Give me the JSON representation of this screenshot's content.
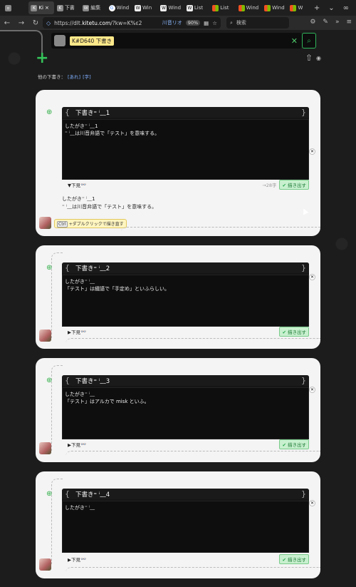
{
  "browser": {
    "tabs": [
      {
        "label": "",
        "icon": "blank"
      },
      {
        "label": "Ki",
        "icon": "kitetu",
        "active": true
      },
      {
        "label": "下書",
        "icon": "kitetu"
      },
      {
        "label": "編集",
        "icon": "wiki"
      },
      {
        "label": "Wind",
        "icon": "google"
      },
      {
        "label": "Win",
        "icon": "w"
      },
      {
        "label": "Wind",
        "icon": "w"
      },
      {
        "label": "List",
        "icon": "w"
      },
      {
        "label": "List",
        "icon": "ms"
      },
      {
        "label": "Wind",
        "icon": "ms"
      },
      {
        "label": "Wind",
        "icon": "ms"
      },
      {
        "label": "W",
        "icon": "ms"
      }
    ],
    "tab_tools": {
      "new_tab": "+",
      "list": "⌄"
    },
    "url_prefix": "https://dlt.",
    "url_host": "kitetu.com",
    "url_rest": "/?kw=K%ε2",
    "user_badge": "川音リオ",
    "zoom": "90%",
    "search_placeholder": "検索",
    "toolbar_icons": [
      "settings-icon",
      "extension-icon",
      "menu-icon"
    ]
  },
  "page": {
    "search_pill": "K#D640 下書き",
    "other_drafts_label": "他の下書き：",
    "other_drafts_links": [
      "[あれ]",
      "[字]"
    ],
    "hint_key": "Ctrl",
    "hint_text": "+ダブルクリックで描き直す",
    "below_label": "▼下見",
    "count_text": "→28字",
    "save_label": "描き出す",
    "cards": [
      {
        "title": "下書き⁼ ⁱ﹏1",
        "lines": [
          "したがき⁼ ⁱ﹏1",
          "⁼ ⁱ﹏は川音弁語で「テスト」を意味する。"
        ],
        "preview": [
          "したがき⁼ ⁱ﹏1",
          "⁼ ⁱ﹏は川音弁語で「テスト」を意味する。"
        ]
      },
      {
        "title": "下書き⁼ ⁱ﹏2",
        "lines": [
          "したがき⁼ ⁱ﹏",
          "「テスト」は綴語で「手定め」といふらしい。"
        ]
      },
      {
        "title": "下書き⁼ ⁱ﹏3",
        "lines": [
          "したがき⁼ ⁱ﹏",
          "「テスト」はアルカで misk といふ。"
        ]
      },
      {
        "title": "下書き⁼ ⁱ﹏4",
        "lines": [
          "したがき⁼ ⁱ﹏"
        ]
      }
    ],
    "below_short": "▶下見",
    "colors": {
      "accent_green": "#35c35a",
      "link_blue": "#7fb0ff",
      "highlight_yellow": "#ffe98a"
    }
  }
}
